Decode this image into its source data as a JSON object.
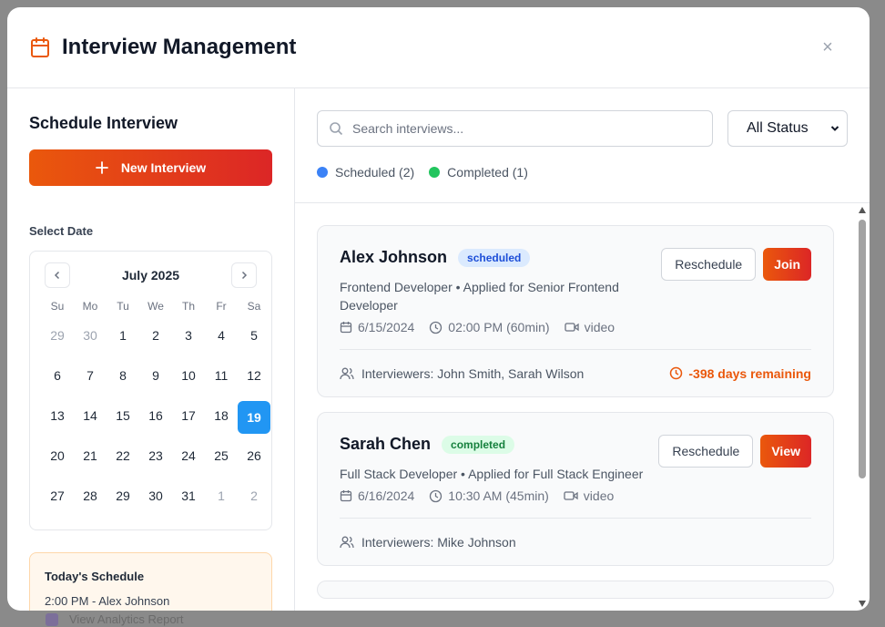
{
  "modal": {
    "title": "Interview Management",
    "close_symbol": "×"
  },
  "left": {
    "section_title": "Schedule Interview",
    "new_button_label": "New Interview",
    "select_date_label": "Select Date",
    "calendar": {
      "month_label": "July 2025",
      "prev_icon": "chevron-left-icon",
      "next_icon": "chevron-right-icon",
      "weekdays": [
        "Su",
        "Mo",
        "Tu",
        "We",
        "Th",
        "Fr",
        "Sa"
      ],
      "selected_day": 19,
      "days": [
        {
          "d": "29",
          "muted": true
        },
        {
          "d": "30",
          "muted": true
        },
        {
          "d": "1"
        },
        {
          "d": "2"
        },
        {
          "d": "3"
        },
        {
          "d": "4"
        },
        {
          "d": "5"
        },
        {
          "d": "6"
        },
        {
          "d": "7"
        },
        {
          "d": "8"
        },
        {
          "d": "9"
        },
        {
          "d": "10"
        },
        {
          "d": "11"
        },
        {
          "d": "12"
        },
        {
          "d": "13"
        },
        {
          "d": "14"
        },
        {
          "d": "15"
        },
        {
          "d": "16"
        },
        {
          "d": "17"
        },
        {
          "d": "18"
        },
        {
          "d": "19",
          "selected": true
        },
        {
          "d": "20"
        },
        {
          "d": "21"
        },
        {
          "d": "22"
        },
        {
          "d": "23"
        },
        {
          "d": "24"
        },
        {
          "d": "25"
        },
        {
          "d": "26"
        },
        {
          "d": "27"
        },
        {
          "d": "28"
        },
        {
          "d": "29"
        },
        {
          "d": "30"
        },
        {
          "d": "31"
        },
        {
          "d": "1",
          "muted": true
        },
        {
          "d": "2",
          "muted": true
        }
      ]
    },
    "today": {
      "title": "Today's Schedule",
      "items": [
        "2:00 PM - Alex Johnson"
      ]
    }
  },
  "right": {
    "search_placeholder": "Search interviews...",
    "status_select_value": "All Status",
    "legend": [
      {
        "label": "Scheduled (2)",
        "color": "#3b82f6"
      },
      {
        "label": "Completed (1)",
        "color": "#22c55e"
      }
    ],
    "cards": [
      {
        "name": "Alex Johnson",
        "status": "scheduled",
        "role": "Frontend Developer • Applied for Senior Frontend Developer",
        "date": "6/15/2024",
        "time": "02:00 PM (60min)",
        "mode": "video",
        "interviewers": "Interviewers: John Smith, Sarah Wilson",
        "remaining": "-398 days remaining",
        "secondary_action": "Reschedule",
        "primary_action": "Join"
      },
      {
        "name": "Sarah Chen",
        "status": "completed",
        "role": "Full Stack Developer • Applied for Full Stack Engineer",
        "date": "6/16/2024",
        "time": "10:30 AM (45min)",
        "mode": "video",
        "interviewers": "Interviewers: Mike Johnson",
        "remaining": "",
        "secondary_action": "Reschedule",
        "primary_action": "View"
      }
    ]
  },
  "backdrop": {
    "text": "View Analytics Report"
  },
  "colors": {
    "accent_gradient_start": "#ea580c",
    "accent_gradient_end": "#dc2626",
    "selected_day": "#2196f3"
  }
}
